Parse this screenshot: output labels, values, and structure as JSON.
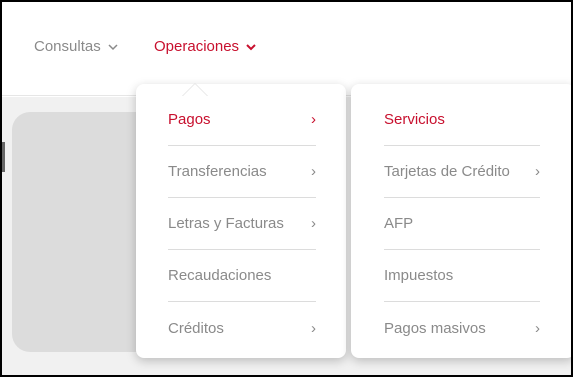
{
  "nav": {
    "consultas_label": "Consultas",
    "operaciones_label": "Operaciones"
  },
  "colors": {
    "accent": "#c8102e",
    "text_muted": "#8a8a8a",
    "divider": "#dcdcdc",
    "background": "#f1f1f1"
  },
  "left_menu": {
    "items": [
      {
        "label": "Pagos",
        "arrow": "›",
        "active": true
      },
      {
        "label": "Transferencias",
        "arrow": "›",
        "active": false
      },
      {
        "label": "Letras y Facturas",
        "arrow": "›",
        "active": false
      },
      {
        "label": "Recaudaciones",
        "arrow": "",
        "active": false
      },
      {
        "label": "Créditos",
        "arrow": "›",
        "active": false
      }
    ]
  },
  "right_menu": {
    "items": [
      {
        "label": "Servicios",
        "arrow": "",
        "active": true
      },
      {
        "label": "Tarjetas de Crédito",
        "arrow": "›",
        "active": false
      },
      {
        "label": "AFP",
        "arrow": "",
        "active": false
      },
      {
        "label": "Impuestos",
        "arrow": "",
        "active": false
      },
      {
        "label": "Pagos masivos",
        "arrow": "›",
        "active": false
      }
    ]
  },
  "icons": {
    "nav_chevron": "chevron-down-icon",
    "submenu_arrow": "chevron-right-icon"
  }
}
